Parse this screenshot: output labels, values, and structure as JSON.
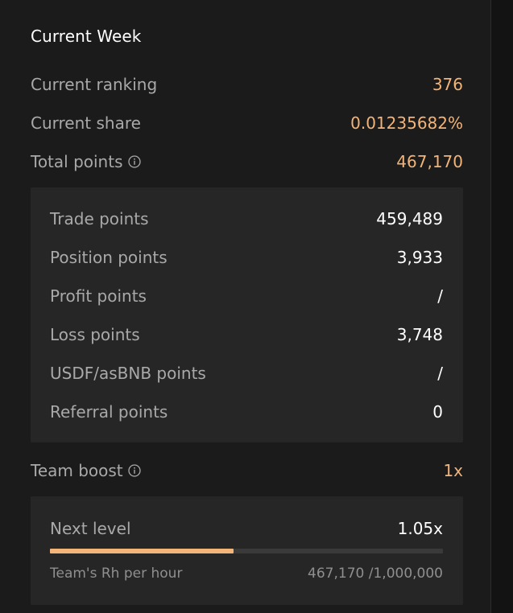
{
  "current_week": {
    "title": "Current Week",
    "ranking": {
      "label": "Current ranking",
      "value": "376"
    },
    "share": {
      "label": "Current share",
      "value": "0.01235682%"
    },
    "total_points": {
      "label": "Total points",
      "value": "467,170",
      "icon": "info-icon"
    }
  },
  "breakdown": [
    {
      "label": "Trade points",
      "value": "459,489"
    },
    {
      "label": "Position points",
      "value": "3,933"
    },
    {
      "label": "Profit points",
      "value": "/"
    },
    {
      "label": "Loss points",
      "value": "3,748"
    },
    {
      "label": "USDF/asBNB points",
      "value": "/"
    },
    {
      "label": "Referral points",
      "value": "0"
    }
  ],
  "team_boost": {
    "label": "Team boost",
    "value": "1x",
    "icon": "info-icon"
  },
  "next_level": {
    "label": "Next level",
    "value": "1.05x",
    "progress_fraction": 0.467,
    "rh_label": "Team's Rh per hour",
    "rh_value": "467,170 /1,000,000"
  },
  "colors": {
    "accent": "#f2b479",
    "label": "#a9a9a9",
    "value": "#ffffff",
    "panel": "#1b1b1b",
    "box": "#262626"
  }
}
